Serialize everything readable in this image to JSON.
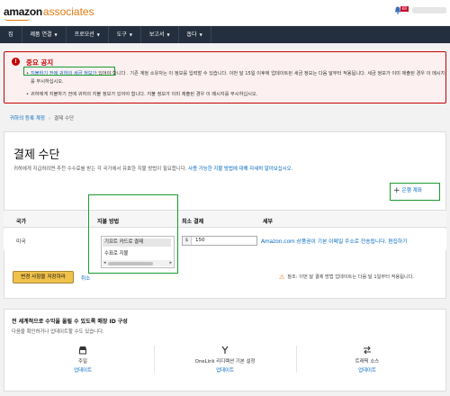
{
  "header": {
    "logo_brand": "amazon",
    "logo_suffix": "associates",
    "flag_text": "KR"
  },
  "nav": {
    "items": [
      {
        "label": "집",
        "dropdown": false
      },
      {
        "label": "제품 연결",
        "dropdown": true
      },
      {
        "label": "프로모션",
        "dropdown": true
      },
      {
        "label": "도구",
        "dropdown": true
      },
      {
        "label": "보고서",
        "dropdown": true
      },
      {
        "label": "돕다",
        "dropdown": true
      }
    ]
  },
  "notice": {
    "title": "중요 공지",
    "line1_highlight": "지불하기 전에 귀하의 세금 정보가",
    "line1_rest": " 있어야 합니다 . 기존 계정 소유자는 이 정보를 입력할 수 있습니다. 이번 달 15일 이후에 업데이트된 세금 정보는 다음 달부터 적용됩니다. 세금 정보가 이미 제출된 경우 이 메시지를 무시하십시오.",
    "line2": "귀하에게 지불하기 전에 귀하의 지불 정보가 있어야 합니다. 지불 정보가 이미 제출된 경우 이 메시지를 무시하십시오."
  },
  "breadcrumb": {
    "parent": "귀하의 등록 계정",
    "separator": "›",
    "current": "결제 수단"
  },
  "payment": {
    "title": "결제 수단",
    "description": "귀하에게 지급하려면 추천 수수료를 받는 각 국가에서 유효한 지불 방법이 필요합니다.",
    "description_link": "사용 가능한 지불 방법에 대해 자세히 알아보십시오.",
    "add_account_label": "은행 계좌",
    "table": {
      "headers": [
        "국가",
        "지불 방법",
        "최소 결제",
        "세부"
      ],
      "row": {
        "country": "미국",
        "methods": [
          "기프트 카드로 결제",
          "수표로 지불"
        ],
        "selected_method": "기프트 카드로 결제",
        "currency": "$",
        "min_amount": "150",
        "detail_text": "Amazon.com 상품권이 기본 이메일 주소로 전송됩니다.",
        "detail_link": "편집하기"
      }
    },
    "save_button": "변경 사항을 저장하라",
    "cancel_link": "취소",
    "warning": "참조: 이번 달 결제 방법 업데이트는 다음 달 1일부터 적용됩니다."
  },
  "bottom": {
    "title": "전 세계적으로 수익을 올릴 수 있도록 매장 ID 구성",
    "description": "다음을 확인하거나 업데이트할 수도 있습니다.",
    "tiles": [
      {
        "icon": "store-icon",
        "label": "주일",
        "link": "업데이트"
      },
      {
        "icon": "route-icon",
        "label": "OneLink 리디렉션 기본 설정",
        "link": "업데이트"
      },
      {
        "icon": "transfer-icon",
        "label": "트래픽 소스",
        "link": "업데이트"
      }
    ]
  },
  "colors": {
    "nav_bg": "#232f3e",
    "brand_orange": "#e47911",
    "link_blue": "#0066c0",
    "alert_red": "#c40000",
    "button_yellow": "#f0c14b",
    "highlight_green": "#1a9b2e"
  }
}
